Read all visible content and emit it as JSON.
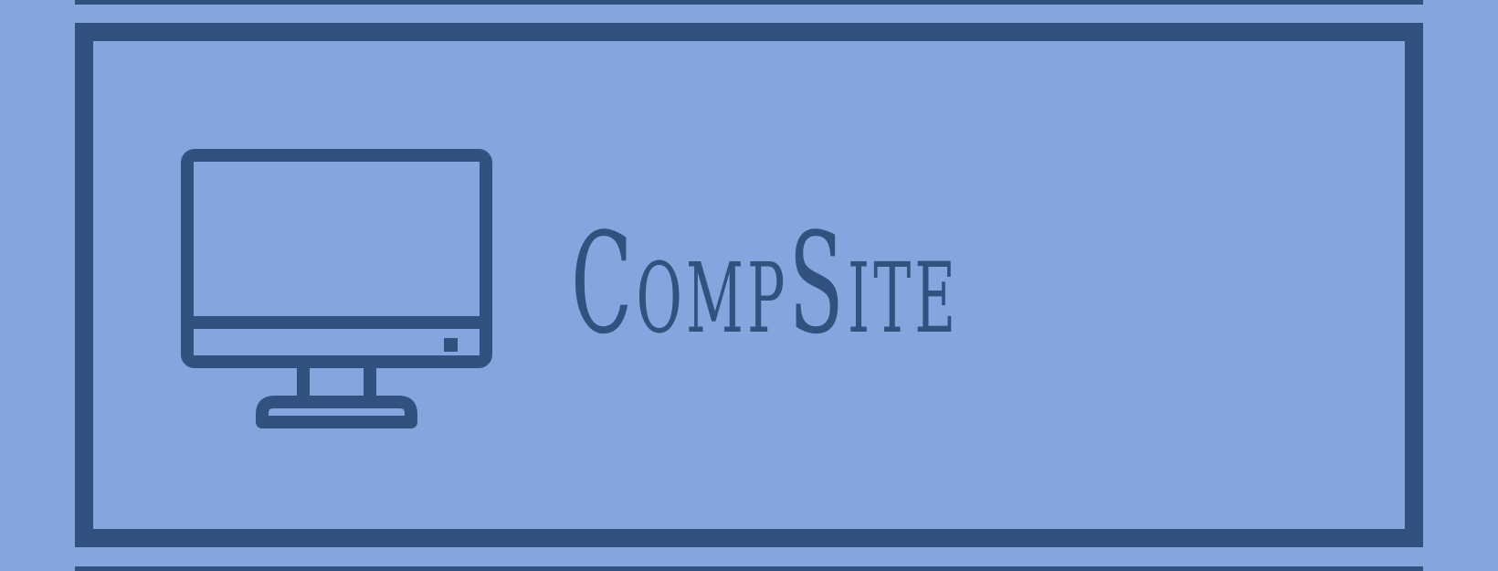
{
  "logo": {
    "icon": "desktop-monitor-icon",
    "brand_name": "CompSite"
  },
  "colors": {
    "background": "#84a5de",
    "ink": "#31527f"
  }
}
